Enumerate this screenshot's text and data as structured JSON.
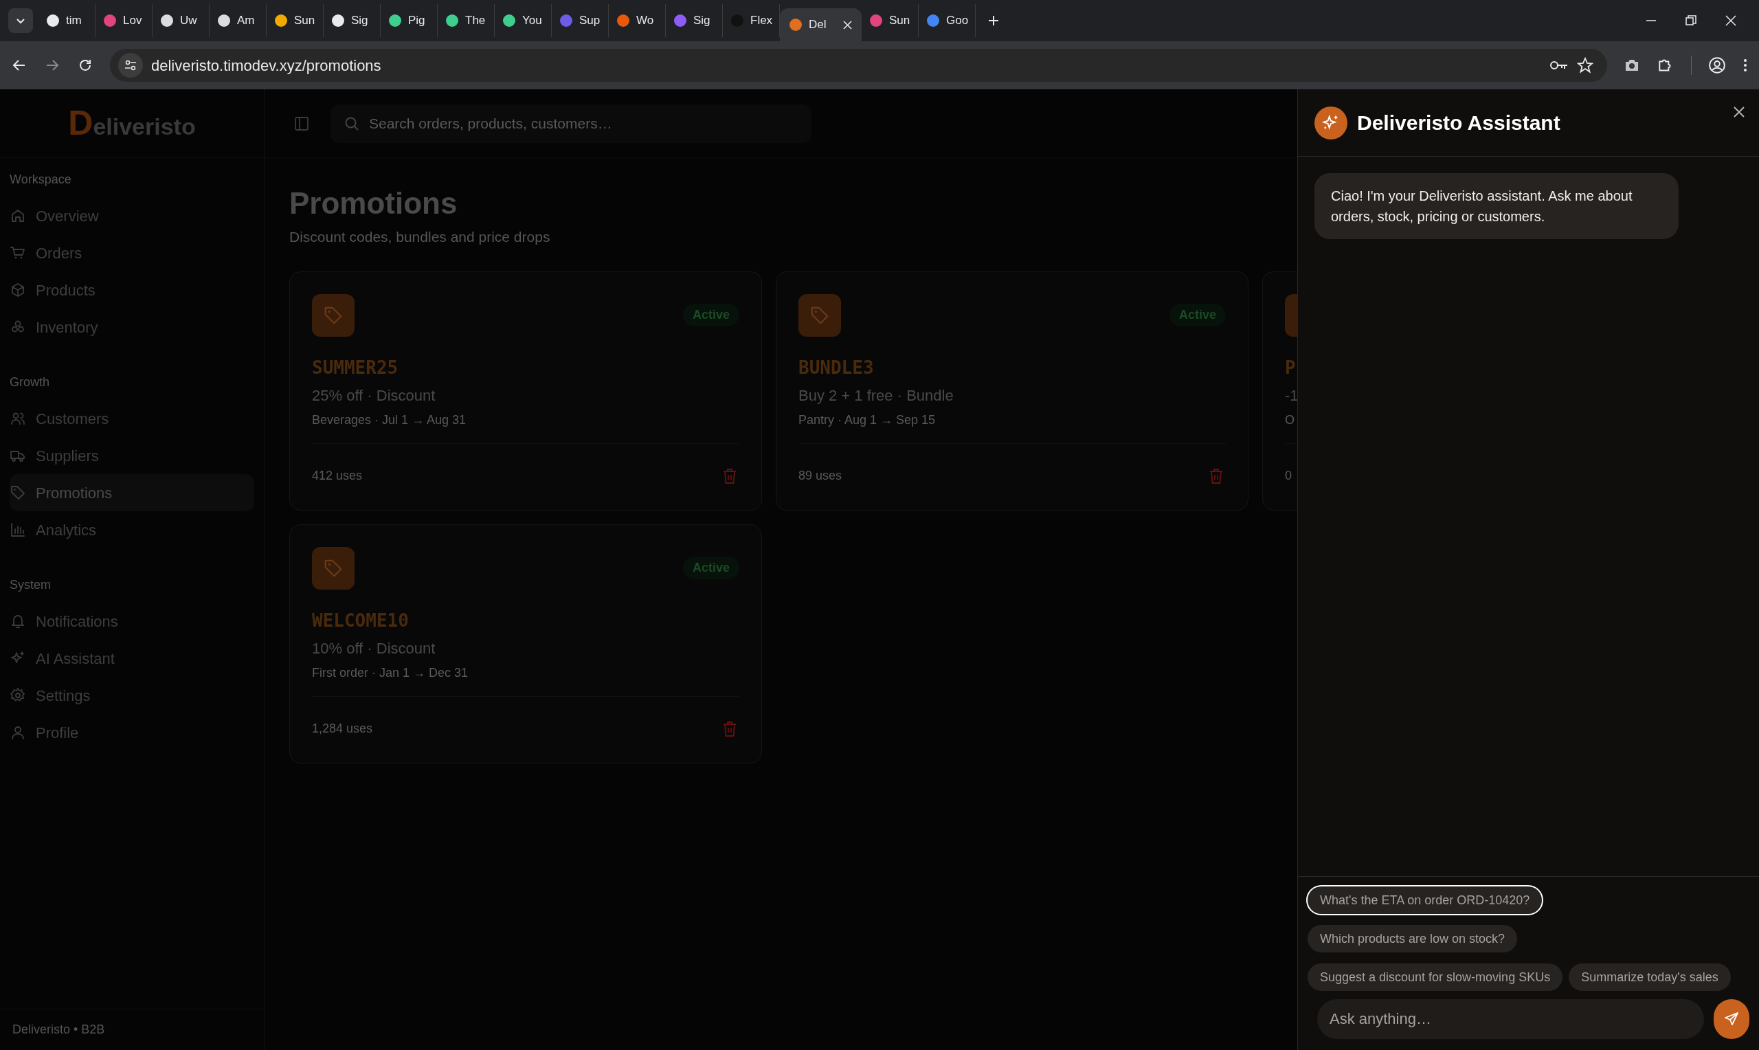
{
  "browser": {
    "tabs": [
      {
        "title": "tim",
        "color": "#e8eaed",
        "selected": false
      },
      {
        "title": "Lov",
        "color": "#e0457b",
        "selected": false
      },
      {
        "title": "Uw",
        "color": "#dadce0",
        "selected": false
      },
      {
        "title": "Am",
        "color": "#dadce0",
        "selected": false
      },
      {
        "title": "Sun",
        "color": "#f2a900",
        "selected": false
      },
      {
        "title": "Sig",
        "color": "#e8eaed",
        "selected": false
      },
      {
        "title": "Pig",
        "color": "#3ecf8e",
        "selected": false
      },
      {
        "title": "The",
        "color": "#3ecf8e",
        "selected": false
      },
      {
        "title": "You",
        "color": "#3ecf8e",
        "selected": false
      },
      {
        "title": "Sup",
        "color": "#6c5ce7",
        "selected": false
      },
      {
        "title": "Wo",
        "color": "#e8590c",
        "selected": false
      },
      {
        "title": "Sig",
        "color": "#8e5cf7",
        "selected": false
      },
      {
        "title": "Flex",
        "color": "#111111",
        "selected": false
      },
      {
        "title": "Del",
        "color": "#e07020",
        "selected": true
      },
      {
        "title": "Sun",
        "color": "#e0457b",
        "selected": false
      },
      {
        "title": "Goo",
        "color": "#4285f4",
        "selected": false
      }
    ],
    "url": "deliveristo.timodev.xyz/promotions"
  },
  "sidebar": {
    "logo": "Deliveristo",
    "sections": [
      {
        "label": "Workspace",
        "items": [
          {
            "label": "Overview",
            "selected": false
          },
          {
            "label": "Orders",
            "selected": false
          },
          {
            "label": "Products",
            "selected": false
          },
          {
            "label": "Inventory",
            "selected": false
          }
        ]
      },
      {
        "label": "Growth",
        "items": [
          {
            "label": "Customers",
            "selected": false
          },
          {
            "label": "Suppliers",
            "selected": false
          },
          {
            "label": "Promotions",
            "selected": true
          },
          {
            "label": "Analytics",
            "selected": false
          }
        ]
      },
      {
        "label": "System",
        "items": [
          {
            "label": "Notifications",
            "selected": false
          },
          {
            "label": "AI Assistant",
            "selected": false
          },
          {
            "label": "Settings",
            "selected": false
          },
          {
            "label": "Profile",
            "selected": false
          }
        ]
      }
    ],
    "footer": "Deliveristo • B2B"
  },
  "search": {
    "placeholder": "Search orders, products, customers…"
  },
  "page": {
    "title": "Promotions",
    "subtitle": "Discount codes, bundles and price drops"
  },
  "promotions": [
    {
      "code": "SUMMER25",
      "status": "Active",
      "detail": "25% off · Discount",
      "meta": "Beverages · Jul 1 → Aug 31",
      "uses": "412 uses",
      "delete_button": true
    },
    {
      "code": "BUNDLE3",
      "status": "Active",
      "detail": "Buy 2 + 1 free · Bundle",
      "meta": "Pantry · Aug 1 → Sep 15",
      "uses": "89 uses",
      "delete_button": true
    },
    {
      "code": "P",
      "detail": "-1",
      "meta": "O",
      "uses": "0"
    },
    {
      "code": "WELCOME10",
      "status": "Active",
      "detail": "10% off · Discount",
      "meta": "First order · Jan 1 → Dec 31",
      "uses": "1,284 uses",
      "delete_button": true
    }
  ],
  "assistant": {
    "title": "Deliveristo Assistant",
    "messages": [
      {
        "text": "Ciao! I'm your Deliveristo assistant. Ask me about orders, stock, pricing or customers."
      }
    ],
    "suggestions": [
      {
        "text": "What's the ETA on order ORD-10420?",
        "focused": true
      },
      {
        "text": "Which products are low on stock?",
        "focused": false
      },
      {
        "text": "Suggest a discount for slow-moving SKUs",
        "focused": false
      },
      {
        "text": "Summarize today's sales",
        "focused": false
      }
    ],
    "input": {
      "placeholder": "Ask anything…"
    }
  }
}
